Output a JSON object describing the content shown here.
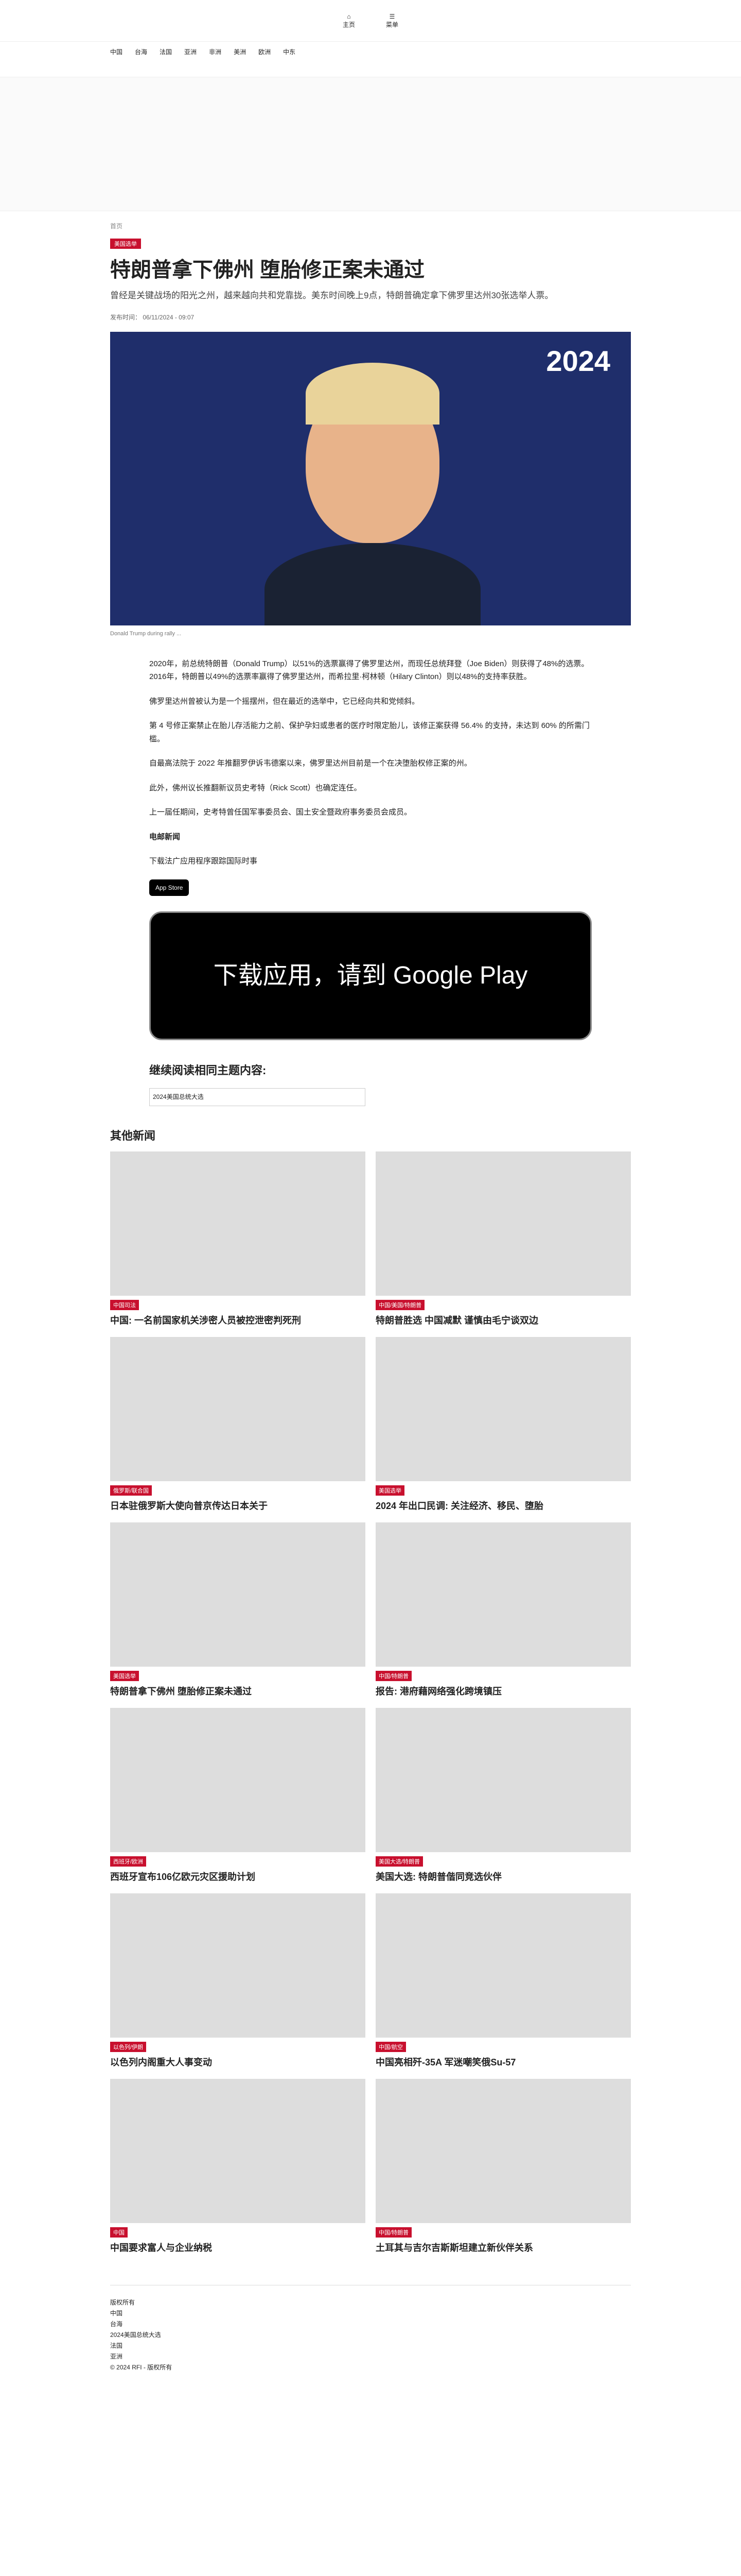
{
  "header": {
    "home_label": "主页",
    "menu_label": "菜单",
    "nav": [
      "中国",
      "台海",
      "法国",
      "亚洲",
      "非洲",
      "美洲",
      "欧洲",
      "中东"
    ]
  },
  "article": {
    "breadcrumb": "首页",
    "tag": "美国选举",
    "title": "特朗普拿下佛州 堕胎修正案未通过",
    "lead": "曾经是关键战场的阳光之州，越来越向共和党靠拢。美东时间晚上9点，特朗普确定拿下佛罗里达州30张选举人票。",
    "meta": "发布时间： 06/11/2024 - 09:07",
    "hero_year": "2024",
    "caption": "Donald Trump during rally ...",
    "paragraphs": [
      "2020年，前总统特朗普（Donald Trump）以51%的选票赢得了佛罗里达州，而现任总统拜登（Joe Biden）则获得了48%的选票。2016年，特朗普以49%的选票率赢得了佛罗里达州，而希拉里·柯林顿（Hilary Clinton）则以48%的支持率获胜。",
      "佛罗里达州曾被认为是一个摇摆州，但在最近的选举中，它已经向共和党倾斜。",
      "第 4 号修正案禁止在胎儿存活能力之前、保护孕妇或患者的医疗时限定胎儿，该修正案获得 56.4% 的支持，未达到 60% 的所需门槛。",
      "自最高法院于 2022 年推翻罗伊诉韦德案以来，佛罗里达州目前是一个在决堕胎权修正案的州。",
      "此外，佛州议长推翻新议员史考特（Rick Scott）也确定连任。",
      "上一届任期间，史考特曾任国军事委员会、国土安全暨政府事务委员会成员。"
    ],
    "subscribe": "电邮新闻",
    "app_label": "下载法广应用程序跟踪国际时事",
    "app_store": "App Store",
    "google_play": "下载应用，请到 Google Play"
  },
  "related": {
    "title": "继续阅读相同主题内容:",
    "tag_input": "2024美国总统大选"
  },
  "other": {
    "title": "其他新闻",
    "cards": [
      {
        "tag": "中国司法",
        "title": "中国: 一名前国家机关涉密人员被控泄密判死刑"
      },
      {
        "tag": "中国/美国/特朗普",
        "title": "特朗普胜选 中国减默 谨慎由毛宁谈双边"
      },
      {
        "tag": "俄罗斯/联合国",
        "title": "日本驻俄罗斯大使向普京传达日本关于"
      },
      {
        "tag": "美国选举",
        "title": "2024 年出口民调: 关注经济、移民、堕胎"
      },
      {
        "tag": "美国选举",
        "title": "特朗普拿下佛州 堕胎修正案未通过"
      },
      {
        "tag": "中国/特朗普",
        "title": "报告: 港府藉网络强化跨境镇压"
      },
      {
        "tag": "西班牙/欧洲",
        "title": "西班牙宣布106亿欧元灾区援助计划"
      },
      {
        "tag": "美国大选/特朗普",
        "title": "美国大选: 特朗普偕同竞选伙伴"
      },
      {
        "tag": "以色列/伊朗",
        "title": "以色列内阁重大人事变动"
      },
      {
        "tag": "中国/航空",
        "title": "中国亮相歼-35A 军迷嘲笑俄Su-57"
      },
      {
        "tag": "中国",
        "title": "中国要求富人与企业纳税"
      },
      {
        "tag": "中国/特朗普",
        "title": "土耳其与吉尔吉斯斯坦建立新伙伴关系"
      }
    ]
  },
  "footer": {
    "lines": [
      "版权所有",
      "中国",
      "台海",
      "2024美国总统大选",
      "法国",
      "亚洲",
      "© 2024 RFI - 版权所有"
    ]
  }
}
